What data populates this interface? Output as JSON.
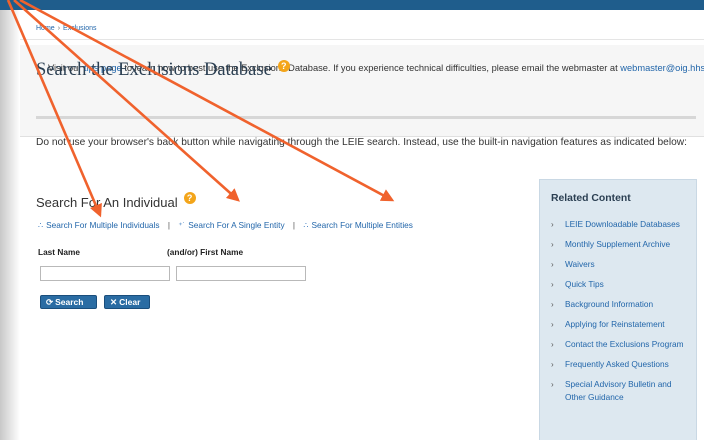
{
  "breadcrumb": {
    "home": "Home",
    "separator": "›",
    "current": "Exclusions"
  },
  "notice": {
    "prefix": "Visit our ",
    "tips_link": "tips page",
    "middle": " to learn how to best use the Exclusions Database. If you experience technical difficulties, please email the webmaster at ",
    "email_link": "webmaster@oig.hhs.gov",
    "suffix": "."
  },
  "page_title": "Search the Exclusions Database",
  "help_glyph": "?",
  "nav_warning": "Do not use your browser's back button while navigating through the LEIE search. Instead, use the built-in navigation features as indicated below:",
  "section_title": "Search For An Individual",
  "search_links": {
    "multiple_individuals": "Search For Multiple Individuals",
    "single_entity": "Search For A Single Entity",
    "multiple_entities": "Search For Multiple Entities",
    "pipe": "|"
  },
  "form": {
    "last_name_label": "Last Name",
    "first_name_label": "(and/or) First Name",
    "last_name_value": "",
    "first_name_value": ""
  },
  "buttons": {
    "search": "Search",
    "clear": "Clear"
  },
  "related": {
    "title": "Related Content",
    "items": [
      "LEIE Downloadable Databases",
      "Monthly Supplement Archive",
      "Waivers",
      "Quick Tips",
      "Background Information",
      "Applying for Reinstatement",
      "Contact the Exclusions Program",
      "Frequently Asked Questions",
      "Special Advisory Bulletin and Other Guidance"
    ]
  },
  "colors": {
    "header_band": "#1f5d8c",
    "link": "#2266aa",
    "button": "#2a6ca3",
    "arrow": "#f0622d",
    "help_icon": "#f3a51a",
    "sidebar": "#dde8f0"
  }
}
